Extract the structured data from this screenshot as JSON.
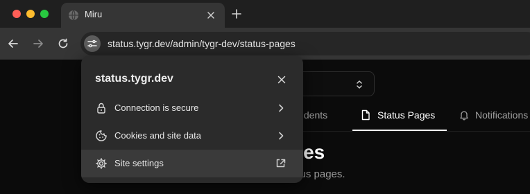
{
  "browser": {
    "tab": {
      "title": "Miru"
    },
    "address_bar": {
      "url": "status.tygr.dev/admin/tygr-dev/status-pages"
    }
  },
  "page": {
    "tabs": [
      {
        "label": "Incidents",
        "visible_text": "ncidents"
      },
      {
        "label": "Status Pages",
        "active": true
      },
      {
        "label": "Notifications"
      }
    ],
    "heading_visible": "ges",
    "subtitle_visible": "atus pages."
  },
  "site_info_popup": {
    "domain": "status.tygr.dev",
    "items": [
      {
        "label": "Connection is secure",
        "icon": "lock-icon",
        "trailing": "chevron-right-icon"
      },
      {
        "label": "Cookies and site data",
        "icon": "cookie-icon",
        "trailing": "chevron-right-icon"
      },
      {
        "label": "Site settings",
        "icon": "gear-icon",
        "trailing": "external-link-icon"
      }
    ]
  },
  "colors": {
    "tabstrip_bg": "#1f1f1f",
    "toolbar_bg": "#353535",
    "popup_bg": "#2b2b2b",
    "popup_hover_row": "#3a3a3a",
    "page_bg": "#0b0b0b",
    "traffic_red": "#ff5f57",
    "traffic_yellow": "#febc2e",
    "traffic_green": "#28c840"
  }
}
